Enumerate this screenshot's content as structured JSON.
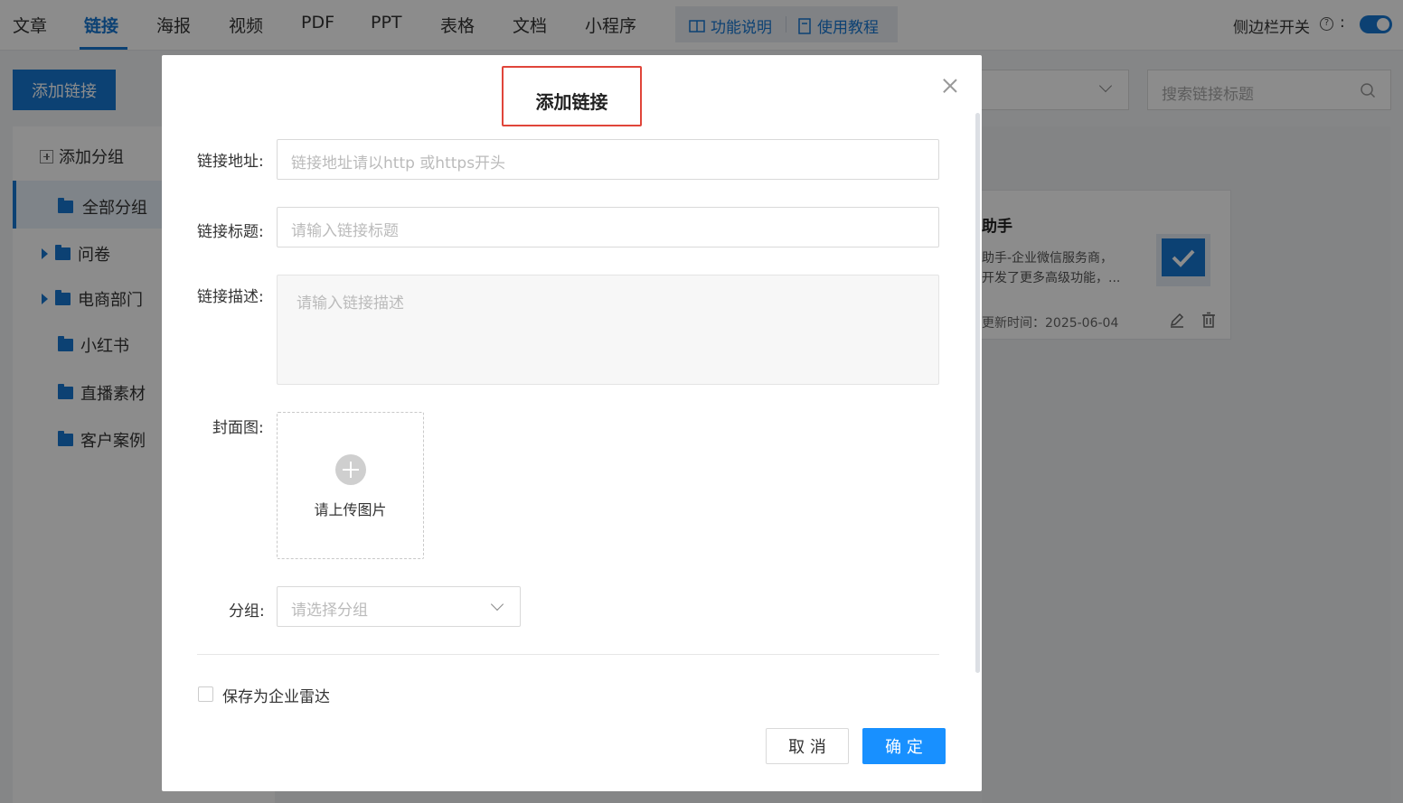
{
  "nav": {
    "tabs": [
      "文章",
      "链接",
      "海报",
      "视频",
      "PDF",
      "PPT",
      "表格",
      "文档",
      "小程序"
    ],
    "active_tab": "链接",
    "help_links": [
      "功能说明",
      "使用教程"
    ],
    "sidebar_toggle_label": "侧边栏开关",
    "sidebar_toggle_on": true,
    "accent_color": "#1677d2"
  },
  "left": {
    "add_link_label": "添加链接",
    "add_group_label": "添加分组",
    "groups": [
      {
        "label": "全部分组",
        "selected": true
      },
      {
        "label": "问卷",
        "expandable": true
      },
      {
        "label": "电商部门",
        "expandable": true
      },
      {
        "label": "小红书"
      },
      {
        "label": "直播素材"
      },
      {
        "label": "客户案例"
      }
    ]
  },
  "right": {
    "search_placeholder": "搜索链接标题",
    "card": {
      "title": "助手",
      "desc_line1": "助手-企业微信服务商，",
      "desc_line2": "开发了更多高级功能，...",
      "updated": "更新时间：2025-06-04"
    }
  },
  "dialog": {
    "title": "添加链接",
    "fields": {
      "url_label": "链接地址:",
      "url_placeholder": "链接地址请以http 或https开头",
      "title_label": "链接标题:",
      "title_placeholder": "请输入链接标题",
      "desc_label": "链接描述:",
      "desc_placeholder": "请输入链接描述",
      "cover_label": "封面图:",
      "upload_text": "请上传图片",
      "group_label": "分组:",
      "group_placeholder": "请选择分组"
    },
    "save_radar_label": "保存为企业雷达",
    "cancel_label": "取 消",
    "ok_label": "确 定",
    "highlight_color": "#e0453a"
  }
}
